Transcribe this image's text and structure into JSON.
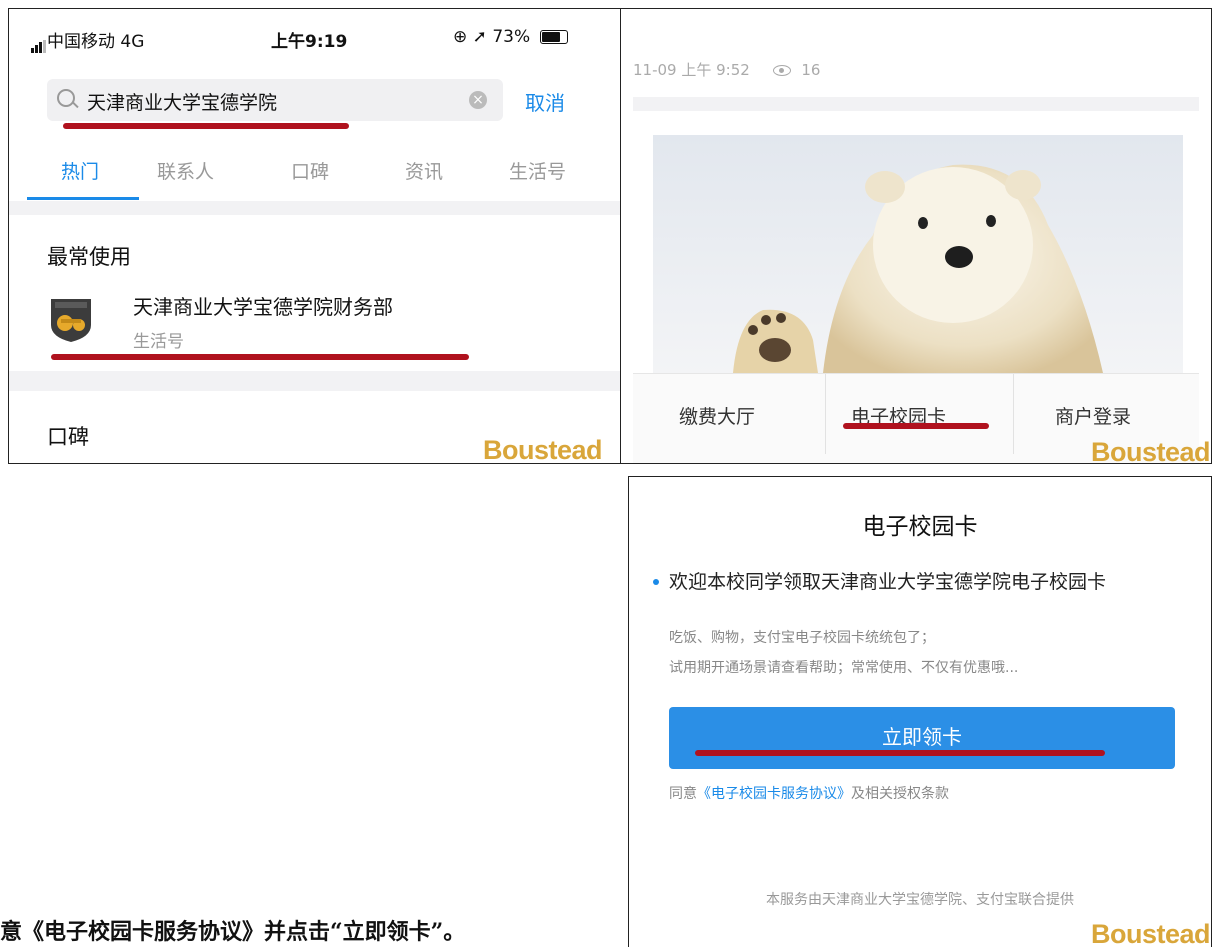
{
  "panel1": {
    "status": {
      "carrier": "中国移动  4G",
      "time": "上午9:19",
      "battery": "73%"
    },
    "search": {
      "query": "天津商业大学宝德学院",
      "cancel": "取消"
    },
    "tabs": [
      "热门",
      "联系人",
      "口碑",
      "资讯",
      "生活号"
    ],
    "active_tab": "热门",
    "section_frequent": "最常使用",
    "result": {
      "title": "天津商业大学宝德学院财务部",
      "subtitle": "生活号"
    },
    "section_reviews": "口碑"
  },
  "panel2": {
    "meta": {
      "datetime": "11-09 上午 9:52",
      "views": "16"
    },
    "image": "polar-bear-banner",
    "buttons": [
      "缴费大厅",
      "电子校园卡",
      "商户登录"
    ]
  },
  "panel3": {
    "title": "电子校园卡",
    "intro": "欢迎本校同学领取天津商业大学宝德学院电子校园卡",
    "line1": "吃饭、购物，支付宝电子校园卡统统包了；",
    "line2": "试用期开通场景请查看帮助；常常使用、不仅有优惠哦...",
    "cta": "立即领卡",
    "agree_prefix": "同意",
    "agree_link": "《电子校园卡服务协议》",
    "agree_suffix": "及相关授权条款",
    "footer": "本服务由天津商业大学宝德学院、支付宝联合提供"
  },
  "watermark": "Boustead",
  "caption": "意《电子校园卡服务协议》并点击“立即领卡”。",
  "colors": {
    "accent": "#1a8ae8",
    "underline": "#b0121e",
    "watermark": "#d9a63a"
  }
}
